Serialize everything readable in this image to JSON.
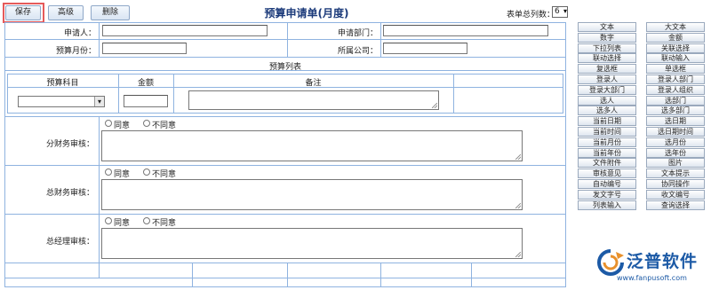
{
  "toolbar": {
    "save_label": "保存",
    "advanced_label": "高级",
    "delete_label": "删除"
  },
  "form": {
    "title": "预算申请单(月度)",
    "total_columns_label": "表单总列数：",
    "total_columns_value": "6",
    "applicant_label": "申请人：",
    "applicant_value": "",
    "department_label": "申请部门：",
    "department_value": "",
    "budget_month_label": "预算月份：",
    "budget_month_value": "",
    "company_label": "所属公司：",
    "company_value": "",
    "budget_list_label": "预算列表",
    "columns": {
      "subject": "预算科目",
      "amount": "金额",
      "remark": "备注"
    },
    "approvals": [
      {
        "label": "分财务审核：",
        "agree": "同意",
        "disagree": "不同意"
      },
      {
        "label": "总财务审核：",
        "agree": "同意",
        "disagree": "不同意"
      },
      {
        "label": "总经理审核：",
        "agree": "同意",
        "disagree": "不同意"
      }
    ]
  },
  "palette": {
    "buttons": [
      [
        "文本",
        "大文本"
      ],
      [
        "数字",
        "金额"
      ],
      [
        "下拉列表",
        "关联选择"
      ],
      [
        "联动选择",
        "联动输入"
      ],
      [
        "复选框",
        "单选框"
      ],
      [
        "登录人",
        "登录人部门"
      ],
      [
        "登录大部门",
        "登录人组织"
      ],
      [
        "选人",
        "选部门"
      ],
      [
        "选多人",
        "选多部门"
      ],
      [
        "当前日期",
        "选日期"
      ],
      [
        "当前时间",
        "选日期时间"
      ],
      [
        "当前月份",
        "选月份"
      ],
      [
        "当前年份",
        "选年份"
      ],
      [
        "文件附件",
        "图片"
      ],
      [
        "审核意见",
        "文本提示"
      ],
      [
        "自动编号",
        "协同操作"
      ],
      [
        "发文字号",
        "收文编号"
      ],
      [
        "列表输入",
        "查询选择"
      ]
    ]
  },
  "logo": {
    "name": "泛普软件",
    "url": "www.fanpusoft.com"
  }
}
